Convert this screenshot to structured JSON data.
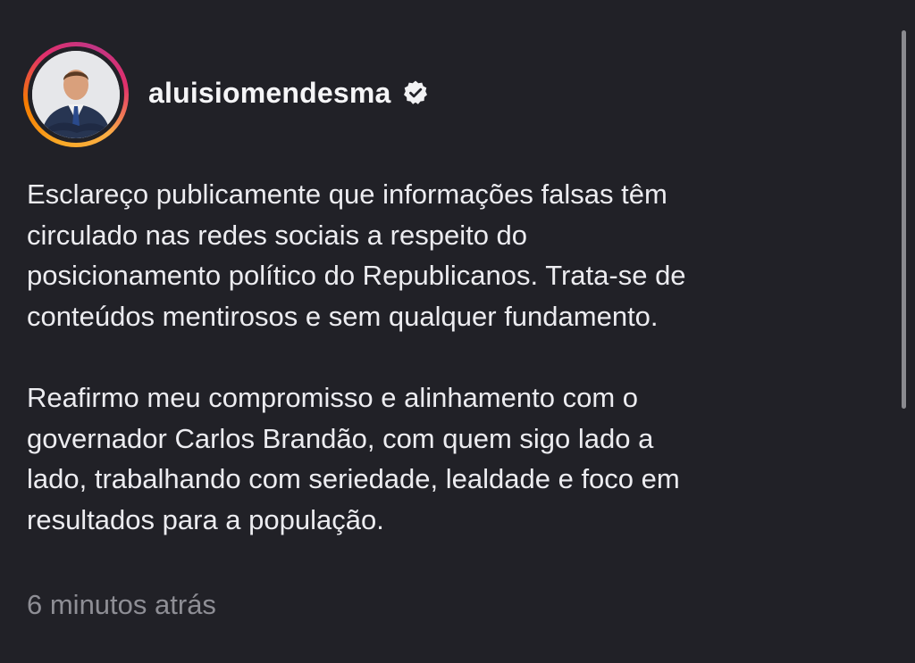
{
  "post": {
    "username": "aluisiomendesma",
    "verified_icon": "verified-badge-icon",
    "paragraphs": [
      "Esclareço publicamente que informações falsas têm\ncirculado nas redes sociais a respeito do\nposicionamento político do Republicanos. Trata-se de\nconteúdos mentirosos e sem qualquer fundamento.",
      "Reafirmo meu compromisso e alinhamento com o\ngovernador Carlos Brandão, com quem sigo lado a\nlado, trabalhando com seriedade, lealdade e foco em\nresultados para a população."
    ],
    "timestamp": "6 minutos atrás"
  },
  "colors": {
    "background": "#212127",
    "text": "#ececf0",
    "timestamp": "#8e8e95",
    "story_ring": [
      "#f9a825",
      "#e1306c",
      "#c13584"
    ]
  }
}
